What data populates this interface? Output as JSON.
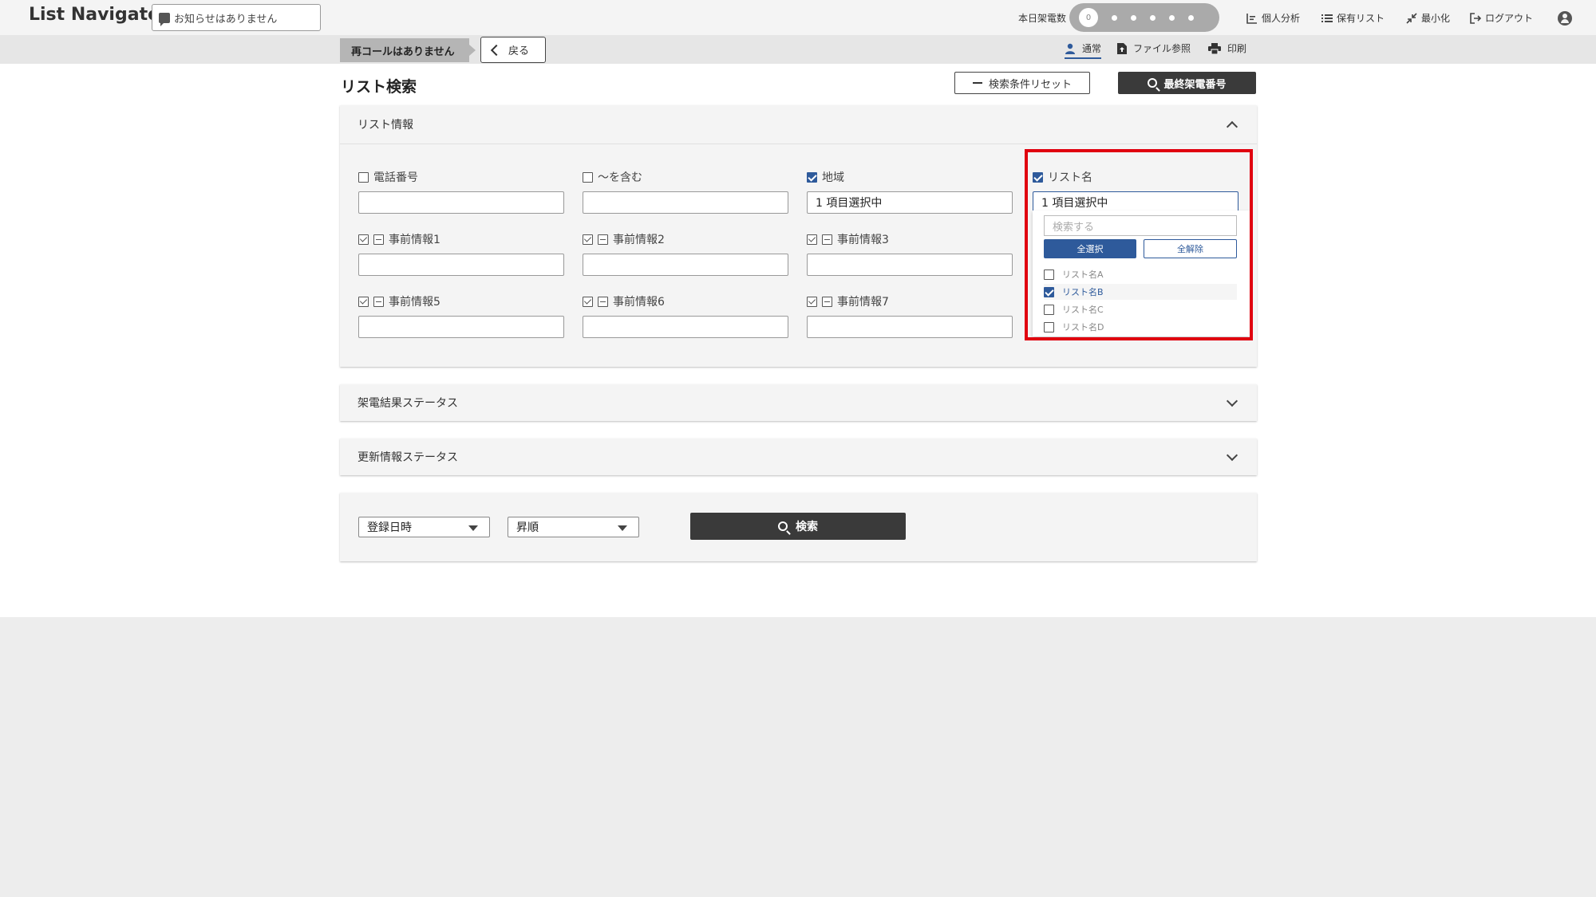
{
  "app": {
    "title": "List Navigator."
  },
  "header": {
    "notice": "お知らせはありません",
    "calls_label": "本日架電数",
    "calls_count": "0",
    "nav": {
      "analysis": "個人分析",
      "saved_lists": "保有リスト",
      "minimize": "最小化",
      "logout": "ログアウト"
    }
  },
  "subbar": {
    "recall": "再コールはありません",
    "back": "戻る",
    "modes": {
      "normal": "通常",
      "file": "ファイル参照",
      "print": "印刷"
    }
  },
  "page": {
    "title": "リスト検索",
    "reset_button": "検索条件リセット",
    "last_number_button": "最終架電番号"
  },
  "list_info": {
    "heading": "リスト情報",
    "fields": {
      "phone": {
        "label": "電話番号",
        "value": ""
      },
      "contains": {
        "label": "～を含む",
        "value": ""
      },
      "region": {
        "label": "地域",
        "value": "1 項目選択中"
      },
      "list_name": {
        "label": "リスト名",
        "value": "1 項目選択中"
      },
      "pre1": {
        "label": "事前情報1",
        "value": ""
      },
      "pre2": {
        "label": "事前情報2",
        "value": ""
      },
      "pre3": {
        "label": "事前情報3",
        "value": ""
      },
      "pre5": {
        "label": "事前情報5",
        "value": ""
      },
      "pre6": {
        "label": "事前情報6",
        "value": ""
      },
      "pre7": {
        "label": "事前情報7",
        "value": ""
      }
    },
    "dropdown": {
      "search_placeholder": "検索する",
      "select_all": "全選択",
      "clear_all": "全解除",
      "options": [
        {
          "label": "リスト名A",
          "checked": false
        },
        {
          "label": "リスト名B",
          "checked": true
        },
        {
          "label": "リスト名C",
          "checked": false
        },
        {
          "label": "リスト名D",
          "checked": false
        }
      ]
    }
  },
  "call_result_status": {
    "heading": "架電結果ステータス"
  },
  "update_status": {
    "heading": "更新情報ステータス"
  },
  "sort": {
    "field": "登録日時",
    "order": "昇順",
    "search_button": "検索"
  },
  "colors": {
    "accent": "#2e5a9b",
    "highlight": "#e0000f",
    "dark_button": "#3a3a3a"
  }
}
